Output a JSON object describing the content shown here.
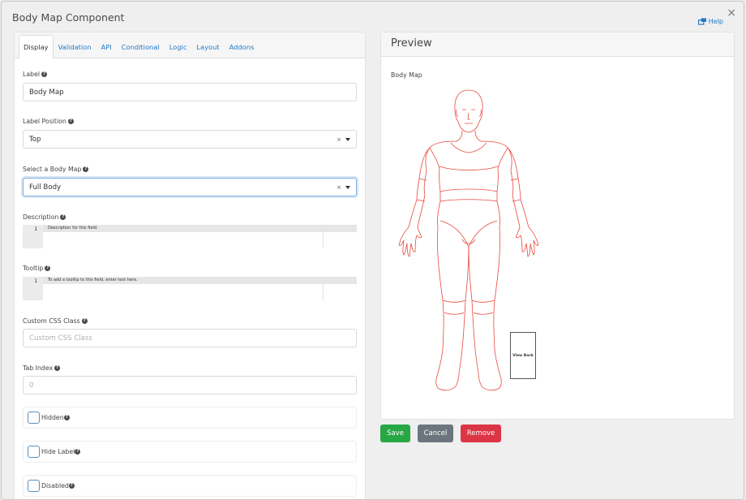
{
  "modal": {
    "title": "Body Map Component",
    "close": "×",
    "help": "Help"
  },
  "tabs": [
    "Display",
    "Validation",
    "API",
    "Conditional",
    "Logic",
    "Layout",
    "Addons"
  ],
  "form": {
    "label": {
      "label": "Label",
      "value": "Body Map"
    },
    "label_position": {
      "label": "Label Position",
      "value": "Top",
      "clear": "×"
    },
    "body_map": {
      "label": "Select a Body Map",
      "value": "Full Body",
      "clear": "×"
    },
    "description": {
      "label": "Description",
      "line_number": "1",
      "placeholder": "Description for this field."
    },
    "tooltip": {
      "label": "Tooltip",
      "line_number": "1",
      "placeholder": "To add a tooltip to this field, enter text here."
    },
    "custom_css": {
      "label": "Custom CSS Class",
      "placeholder": "Custom CSS Class"
    },
    "tab_index": {
      "label": "Tab Index",
      "placeholder": "0"
    },
    "checkboxes": [
      "Hidden",
      "Hide Label",
      "Disabled"
    ]
  },
  "preview": {
    "title": "Preview",
    "component_label": "Body Map",
    "view_back": "View Back"
  },
  "buttons": {
    "save": "Save",
    "cancel": "Cancel",
    "remove": "Remove"
  },
  "colors": {
    "accent": "#2079c7",
    "figure_stroke": "#e8483c",
    "save": "#28a745",
    "cancel": "#6c757d",
    "remove": "#dc3545"
  }
}
